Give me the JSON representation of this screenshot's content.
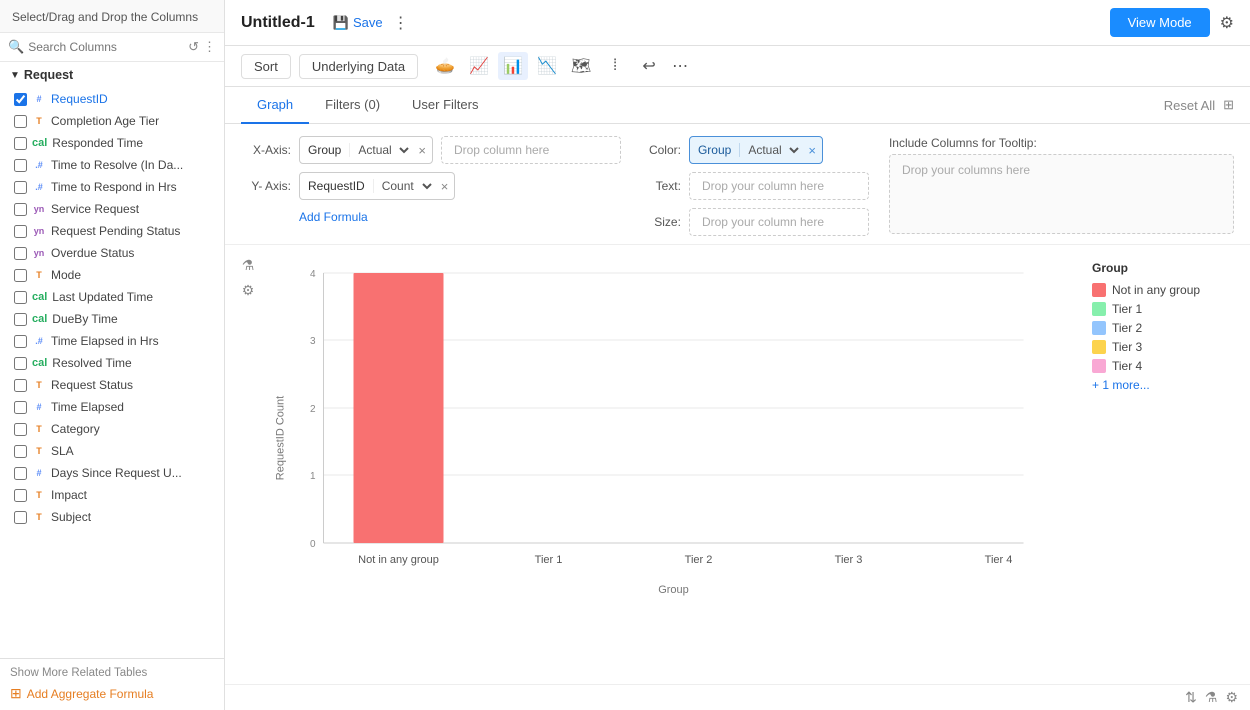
{
  "sidebar": {
    "header": "Select/Drag and Drop the Columns",
    "search_placeholder": "Search Columns",
    "section_name": "Request",
    "items": [
      {
        "id": "requestid",
        "label": "RequestID",
        "type": "#",
        "type_label": "#",
        "type_class": "hash",
        "selected": true
      },
      {
        "id": "completion-age-tier",
        "label": "Completion Age Tier",
        "type": "T",
        "type_label": "T",
        "type_class": "t-badge",
        "selected": false
      },
      {
        "id": "responded-time",
        "label": "Responded Time",
        "type": "cal",
        "type_label": "🗓",
        "type_class": "calendar",
        "selected": false
      },
      {
        "id": "time-to-resolve",
        "label": "Time to Resolve (In Da...",
        "type": ".#",
        "type_label": ".#",
        "type_class": "hash",
        "selected": false
      },
      {
        "id": "time-to-respond",
        "label": "Time to Respond in Hrs",
        "type": ".#",
        "type_label": ".#",
        "type_class": "hash",
        "selected": false
      },
      {
        "id": "service-request",
        "label": "Service Request",
        "type": "yn",
        "type_label": "YN",
        "type_class": "yn",
        "selected": false
      },
      {
        "id": "request-pending-status",
        "label": "Request Pending Status",
        "type": "yn",
        "type_label": "YN",
        "type_class": "yn",
        "selected": false
      },
      {
        "id": "overdue-status",
        "label": "Overdue Status",
        "type": "yn",
        "type_label": "YN",
        "type_class": "yn",
        "selected": false
      },
      {
        "id": "mode",
        "label": "Mode",
        "type": "T",
        "type_label": "T",
        "type_class": "t-badge",
        "selected": false
      },
      {
        "id": "last-updated-time",
        "label": "Last Updated Time",
        "type": "cal",
        "type_label": "🗓",
        "type_class": "calendar",
        "selected": false
      },
      {
        "id": "dueby-time",
        "label": "DueBy Time",
        "type": "cal",
        "type_label": "🗓",
        "type_class": "calendar",
        "selected": false
      },
      {
        "id": "time-elapsed-hrs",
        "label": "Time Elapsed in Hrs",
        "type": ".#",
        "type_label": ".#",
        "type_class": "hash",
        "selected": false
      },
      {
        "id": "resolved-time",
        "label": "Resolved Time",
        "type": "cal",
        "type_label": "🗓",
        "type_class": "calendar",
        "selected": false
      },
      {
        "id": "request-status",
        "label": "Request Status",
        "type": "T",
        "type_label": "T",
        "type_class": "t-badge",
        "selected": false
      },
      {
        "id": "time-elapsed",
        "label": "Time Elapsed",
        "type": "#",
        "type_label": "#",
        "type_class": "hash",
        "selected": false
      },
      {
        "id": "category",
        "label": "Category",
        "type": "T",
        "type_label": "T",
        "type_class": "t-badge",
        "selected": false
      },
      {
        "id": "sla",
        "label": "SLA",
        "type": "T",
        "type_label": "T",
        "type_class": "t-badge",
        "selected": false
      },
      {
        "id": "days-since-request",
        "label": "Days Since Request U...",
        "type": "#",
        "type_label": "#",
        "type_class": "hash",
        "selected": false
      },
      {
        "id": "impact",
        "label": "Impact",
        "type": "T",
        "type_label": "T",
        "type_class": "t-badge",
        "selected": false
      },
      {
        "id": "subject",
        "label": "Subject",
        "type": "T",
        "type_label": "T",
        "type_class": "t-badge",
        "selected": false
      }
    ],
    "show_more_label": "Show More Related Tables",
    "add_formula_label": "Add Aggregate Formula"
  },
  "header": {
    "title": "Untitled-1",
    "save_label": "Save",
    "view_mode_label": "View Mode"
  },
  "toolbar": {
    "sort_label": "Sort",
    "underlying_data_label": "Underlying Data",
    "more_label": "⋯"
  },
  "tabs": {
    "graph_label": "Graph",
    "filters_label": "Filters (0)",
    "user_filters_label": "User Filters",
    "reset_all_label": "Reset All"
  },
  "xaxis": {
    "label": "X-Axis:",
    "field": "Group",
    "aggregate": "Actual",
    "drop_placeholder": "Drop column here"
  },
  "yaxis": {
    "label": "Y- Axis:",
    "field": "RequestID",
    "aggregate": "Count",
    "add_formula_label": "Add Formula"
  },
  "color": {
    "label": "Color:",
    "field": "Group",
    "aggregate": "Actual"
  },
  "text_config": {
    "label": "Text:",
    "placeholder": "Drop your column here"
  },
  "size_config": {
    "label": "Size:",
    "placeholder": "Drop your column here"
  },
  "tooltip": {
    "label": "Include Columns for Tooltip:",
    "placeholder": "Drop your columns here"
  },
  "chart": {
    "y_axis_title": "RequestID Count",
    "x_axis_title": "Group",
    "y_ticks": [
      "0",
      "1",
      "2",
      "3",
      "4"
    ],
    "bars": [
      {
        "label": "Not in any group",
        "value": 4,
        "color": "#f87171"
      },
      {
        "label": "Tier 1",
        "value": 0,
        "color": "#86efac"
      },
      {
        "label": "Tier 2",
        "value": 0,
        "color": "#93c5fd"
      },
      {
        "label": "Tier 3",
        "value": 0,
        "color": "#fcd34d"
      },
      {
        "label": "Tier 4",
        "value": 0,
        "color": "#f9a8d4"
      }
    ]
  },
  "legend": {
    "title": "Group",
    "items": [
      {
        "label": "Not in any group",
        "color": "#f87171"
      },
      {
        "label": "Tier 1",
        "color": "#86efac"
      },
      {
        "label": "Tier 2",
        "color": "#93c5fd"
      },
      {
        "label": "Tier 3",
        "color": "#fcd34d"
      },
      {
        "label": "Tier 4",
        "color": "#f9a8d4"
      }
    ],
    "more_label": "+ 1 more..."
  }
}
